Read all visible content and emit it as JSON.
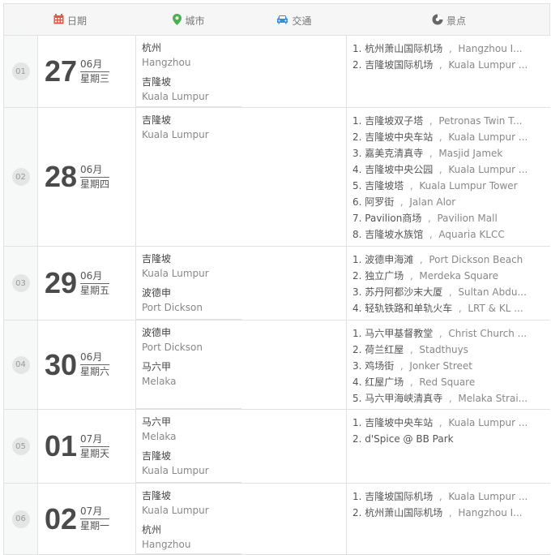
{
  "header": {
    "date": "日期",
    "city": "城市",
    "traffic": "交通",
    "spot": "景点",
    "date_icon_color": "#e05a4e",
    "city_icon_color": "#4caf50",
    "traffic_icon_color": "#3a8fd8",
    "spot_icon_color": "#666666"
  },
  "rows": [
    {
      "num": "01",
      "day": "27",
      "month": "06月",
      "weekday": "星期三",
      "cities": [
        {
          "cn": "杭州",
          "en": "Hangzhou"
        },
        {
          "cn": "吉隆坡",
          "en": "Kuala Lumpur"
        }
      ],
      "spots": [
        {
          "cn": "1. 杭州萧山国际机场",
          "en": "Hangzhou I..."
        },
        {
          "cn": "2. 吉隆坡国际机场",
          "en": "Kuala Lumpur ..."
        }
      ]
    },
    {
      "num": "02",
      "day": "28",
      "month": "06月",
      "weekday": "星期四",
      "cities": [
        {
          "cn": "吉隆坡",
          "en": "Kuala Lumpur"
        }
      ],
      "spots": [
        {
          "cn": "1. 吉隆坡双子塔",
          "en": "Petronas Twin T..."
        },
        {
          "cn": "2. 吉隆坡中央车站",
          "en": "Kuala Lumpur ..."
        },
        {
          "cn": "3. 嘉美克清真寺",
          "en": "Masjid Jamek"
        },
        {
          "cn": "4. 吉隆坡中央公园",
          "en": "Kuala Lumpur ..."
        },
        {
          "cn": "5. 吉隆坡塔",
          "en": "Kuala Lumpur Tower"
        },
        {
          "cn": "6. 阿罗街",
          "en": "Jalan Alor"
        },
        {
          "cn": "7. Pavilion商场",
          "en": "Pavilion Mall"
        },
        {
          "cn": "8. 吉隆坡水族馆",
          "en": "Aquaria KLCC"
        }
      ]
    },
    {
      "num": "03",
      "day": "29",
      "month": "06月",
      "weekday": "星期五",
      "cities": [
        {
          "cn": "吉隆坡",
          "en": "Kuala Lumpur"
        },
        {
          "cn": "波德申",
          "en": "Port Dickson"
        }
      ],
      "spots": [
        {
          "cn": "1. 波德申海滩",
          "en": "Port Dickson Beach"
        },
        {
          "cn": "2. 独立广场",
          "en": "Merdeka Square"
        },
        {
          "cn": "3. 苏丹阿都沙末大厦",
          "en": "Sultan Abdu..."
        },
        {
          "cn": "4. 轻轨铁路和单轨火车",
          "en": "LRT & KL ..."
        }
      ]
    },
    {
      "num": "04",
      "day": "30",
      "month": "06月",
      "weekday": "星期六",
      "cities": [
        {
          "cn": "波德申",
          "en": "Port Dickson"
        },
        {
          "cn": "马六甲",
          "en": "Melaka"
        }
      ],
      "spots": [
        {
          "cn": "1. 马六甲基督教堂",
          "en": "Christ Church ..."
        },
        {
          "cn": "2. 荷兰红屋",
          "en": "Stadthuys"
        },
        {
          "cn": "3. 鸡场街",
          "en": "Jonker Street"
        },
        {
          "cn": "4. 红屋广场",
          "en": "Red Square"
        },
        {
          "cn": "5. 马六甲海峡清真寺",
          "en": "Melaka Strai..."
        }
      ]
    },
    {
      "num": "05",
      "day": "01",
      "month": "07月",
      "weekday": "星期天",
      "cities": [
        {
          "cn": "马六甲",
          "en": "Melaka"
        },
        {
          "cn": "吉隆坡",
          "en": "Kuala Lumpur"
        }
      ],
      "spots": [
        {
          "cn": "1. 吉隆坡中央车站",
          "en": "Kuala Lumpur ..."
        },
        {
          "cn": "2. d'Spice @ BB Park",
          "en": ""
        }
      ]
    },
    {
      "num": "06",
      "day": "02",
      "month": "07月",
      "weekday": "星期一",
      "cities": [
        {
          "cn": "吉隆坡",
          "en": "Kuala Lumpur"
        },
        {
          "cn": "杭州",
          "en": "Hangzhou"
        }
      ],
      "spots": [
        {
          "cn": "1. 吉隆坡国际机场",
          "en": "Kuala Lumpur ..."
        },
        {
          "cn": "2. 杭州萧山国际机场",
          "en": "Hangzhou I..."
        }
      ]
    }
  ]
}
